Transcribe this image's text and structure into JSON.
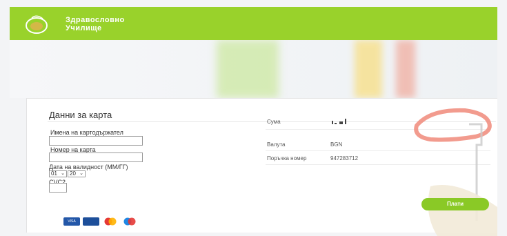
{
  "header": {
    "brand_line1": "Здравословно",
    "brand_line2": "Училище"
  },
  "card": {
    "title": "Данни за карта",
    "fields": {
      "cardholder_label": "Имена на картодържател",
      "card_number_label": "Номер на карта",
      "expiry_label": "Дата на валидност (ММ/ГГ)",
      "expiry_month": "01",
      "expiry_year": "20",
      "cvc_label": "CVC2"
    },
    "summary": {
      "amount_label": "Сума",
      "currency_label": "Валута",
      "currency_value": "BGN",
      "order_label": "Поръчка номер",
      "order_value": "947283712"
    },
    "pay_button": "Плати",
    "card_brands": [
      "VISA",
      "VISA Electron",
      "Mastercard",
      "Maestro"
    ]
  },
  "colors": {
    "brand_green": "#99d22b",
    "button_green": "#8ac926"
  }
}
